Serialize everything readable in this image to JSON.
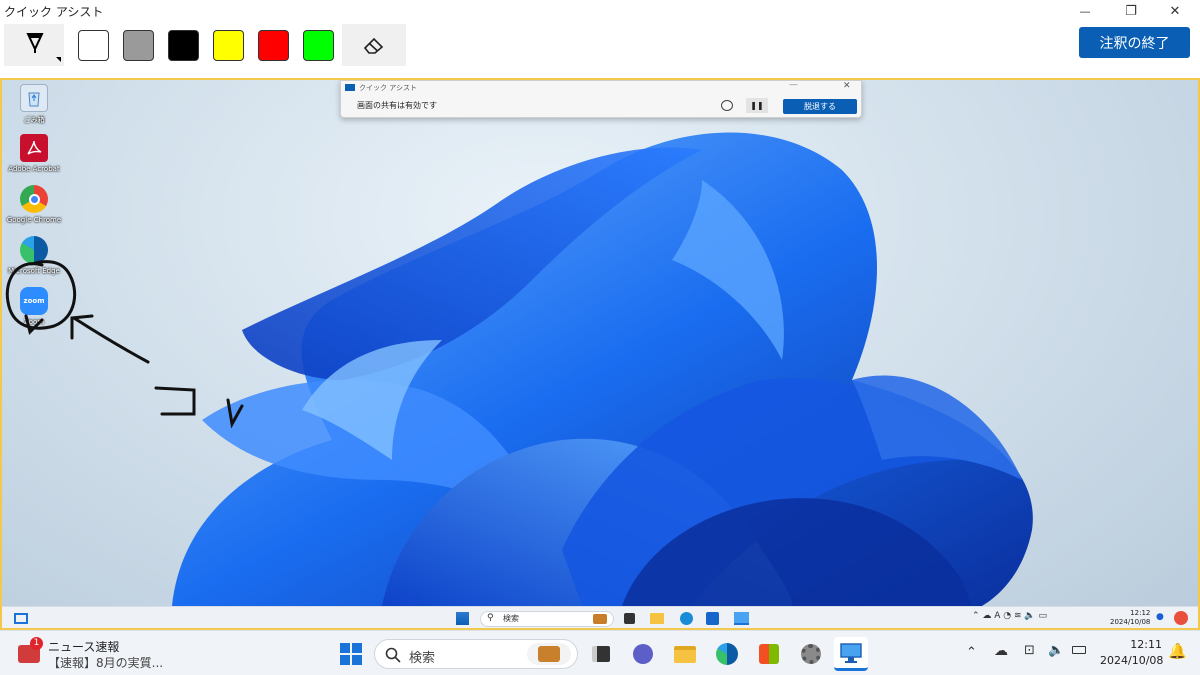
{
  "window": {
    "title": "クイック アシスト",
    "minimize_glyph": "—",
    "maximize_glyph": "❐",
    "close_glyph": "✕"
  },
  "toolbar": {
    "pen_icon": "pen-icon",
    "colors": [
      "#ffffff",
      "#9a9a9a",
      "#000000",
      "#ffff00",
      "#ff0000",
      "#00ff00"
    ],
    "eraser_icon": "eraser-icon",
    "end_annotation_label": "注釈の終了"
  },
  "remote_screen": {
    "desktop_icons": [
      {
        "label": "ごみ箱",
        "icon": "recycle-bin-icon"
      },
      {
        "label": "Adobe Acrobat",
        "icon": "acrobat-icon"
      },
      {
        "label": "Google Chrome",
        "icon": "chrome-icon"
      },
      {
        "label": "Microsoft Edge",
        "icon": "edge-icon"
      },
      {
        "label": "Zoom",
        "icon": "zoom-icon"
      }
    ],
    "annotation_text": "コレ",
    "inner_quick_assist": {
      "title": "クイック アシスト",
      "share_status": "画面の共有は有効です",
      "leave_label": "脱退する"
    },
    "inner_taskbar": {
      "search_placeholder": "検索",
      "time": "12:12",
      "date": "2024/10/08"
    }
  },
  "taskbar": {
    "news_badge": "1",
    "news_title": "ニュース速報",
    "news_headline": "【速報】8月の実質...",
    "search_placeholder": "検索",
    "time": "12:11",
    "date": "2024/10/08"
  },
  "colors": {
    "accent": "#0a5fb4",
    "annotation_border": "#f2c94c"
  }
}
